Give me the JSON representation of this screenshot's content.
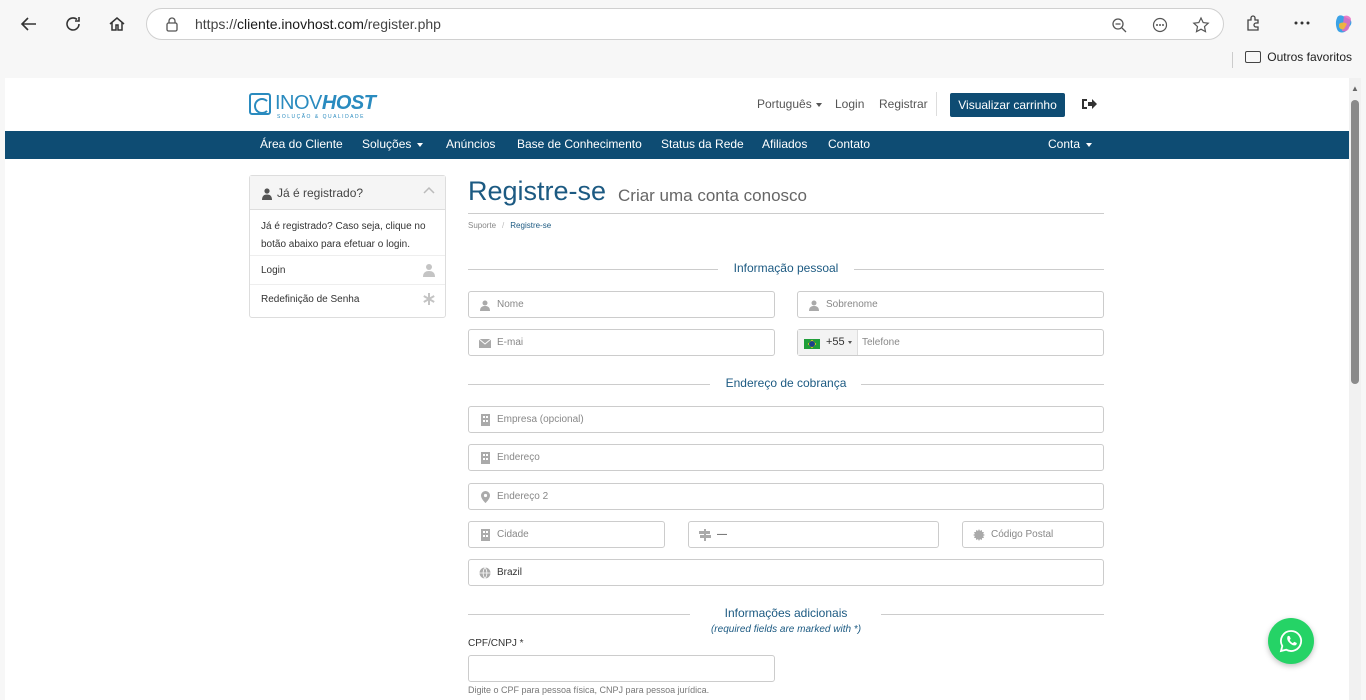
{
  "browser": {
    "url_prefix": "https://",
    "url_domain": "cliente.inovhost.com",
    "url_path": "/register.php",
    "favorites_label": "Outros favoritos"
  },
  "header": {
    "logo_light": "INOV",
    "logo_bold": "HOST",
    "logo_tagline": "SOLUÇÃO & QUALIDADE",
    "language": "Português",
    "login": "Login",
    "register": "Registrar",
    "cart_button": "Visualizar carrinho"
  },
  "nav": {
    "items": [
      "Área do Cliente",
      "Soluções",
      "Anúncios",
      "Base de Conhecimento",
      "Status da Rede",
      "Afiliados",
      "Contato"
    ],
    "account": "Conta"
  },
  "sidebar": {
    "title": "Já é registrado?",
    "body": "Já é registrado? Caso seja, clique no botão abaixo para efetuar o login.",
    "links": [
      "Login",
      "Redefinição de Senha"
    ]
  },
  "page": {
    "title": "Registre-se",
    "subtitle": "Criar uma conta conosco",
    "breadcrumb": [
      "Suporte",
      "Registre-se"
    ]
  },
  "sections": {
    "personal": "Informação pessoal",
    "billing": "Endereço de cobrança",
    "additional": "Informações adicionais",
    "required_note": "(required fields are marked with *)"
  },
  "fields": {
    "first_name": "Nome",
    "last_name": "Sobrenome",
    "email": "E-mai",
    "phone_code": "+55",
    "phone": "Telefone",
    "company": "Empresa (opcional)",
    "address1": "Endereço",
    "address2": "Endereço 2",
    "city": "Cidade",
    "state": "—",
    "postcode": "Código Postal",
    "country": "Brazil",
    "cpf_label": "CPF/CNPJ *",
    "cpf_hint": "Digite o CPF para pessoa física, CNPJ para pessoa jurídica."
  }
}
